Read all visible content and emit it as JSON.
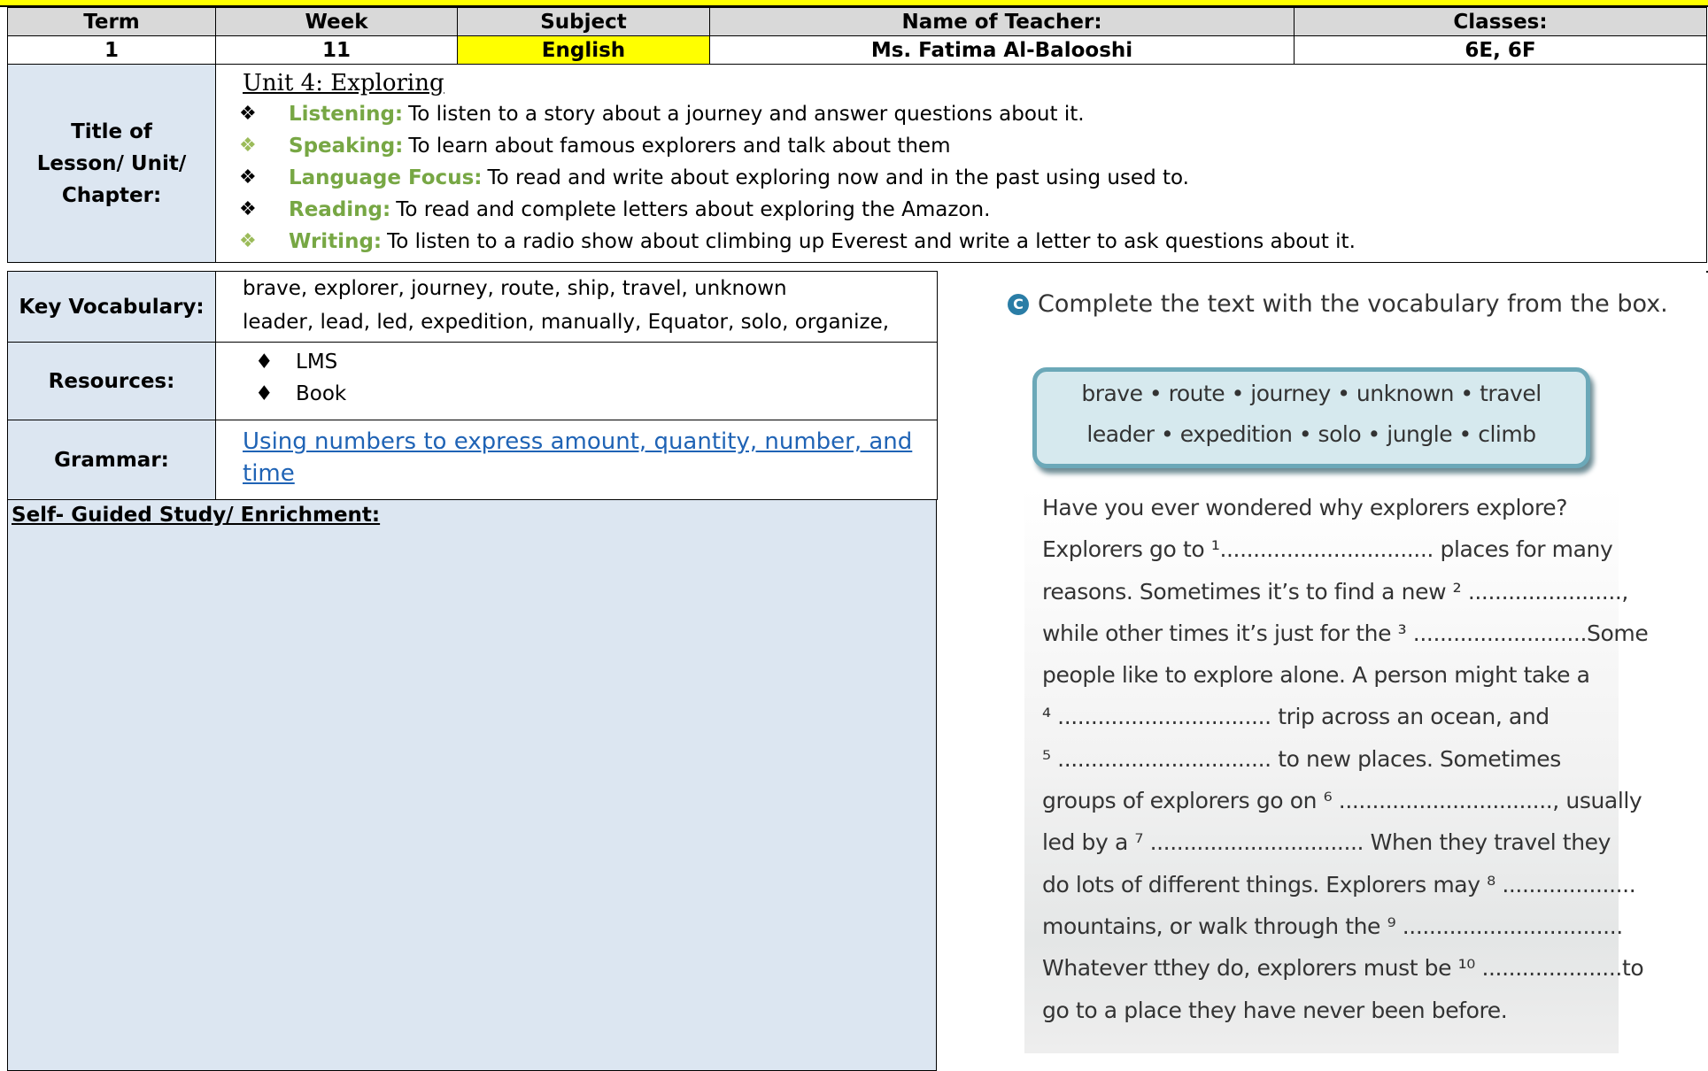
{
  "header": {
    "columns": [
      "Term",
      "Week",
      "Subject",
      "Name of Teacher:",
      "Classes:"
    ],
    "values": [
      "1",
      "11",
      "English",
      "Ms. Fatima Al-Balooshi",
      "6E, 6F"
    ]
  },
  "lesson": {
    "label": "Title of Lesson/ Unit/ Chapter:",
    "unit_title": "Unit 4: Exploring",
    "objectives": [
      {
        "key": "Listening:",
        "text": "To listen to a story about a journey and answer questions about it."
      },
      {
        "key": "Speaking:",
        "text": "To learn about famous explorers and talk about them"
      },
      {
        "key": "Language Focus:",
        "text": "To read and write about exploring now and in the past using used to."
      },
      {
        "key": "Reading:",
        "text": "To read and complete letters about exploring the Amazon."
      },
      {
        "key": "Writing:",
        "text": "To listen to a radio show about climbing up Everest and write a letter to ask questions about it."
      }
    ]
  },
  "vocabulary": {
    "label": "Key Vocabulary:",
    "lines": [
      "brave, explorer, journey, route, ship, travel, unknown",
      "leader, lead, led, expedition, manually, Equator, solo, organize,"
    ]
  },
  "resources": {
    "label": "Resources:",
    "items": [
      "LMS",
      "Book"
    ],
    "bullet": "♦"
  },
  "grammar": {
    "label": "Grammar:",
    "link_text": "Using numbers to express amount, quantity, number, and time"
  },
  "self_study": {
    "label": "Self- Guided Study/ Enrichment:"
  },
  "exercise": {
    "number": "C",
    "instruction": "Complete the text with the vocabulary from the box.",
    "word_rows": [
      "brave  •  route  •  journey  •  unknown  •  travel",
      "leader  •  expedition  •  solo  •  jungle  •  climb"
    ],
    "passage_lines": [
      "Have you ever wondered why explorers explore?",
      "Explorers go to ¹................................ places for many",
      "reasons.  Sometimes it’s to find a new ² .......................,",
      "while other times it’s just for the ³ ..........................Some",
      "people like to explore alone. A person might take a",
      "⁴ ................................ trip across an ocean, and",
      "⁵ ................................ to new places.  Sometimes",
      "groups of explorers go on ⁶ ................................, usually",
      "led by a ⁷ ................................ When they travel they",
      "do lots of different things. Explorers may ⁸ ....................",
      "mountains, or walk through the ⁹ .................................",
      "Whatever tthey do, explorers must be ¹⁰ .....................to",
      "go to a place they have never been before."
    ]
  }
}
